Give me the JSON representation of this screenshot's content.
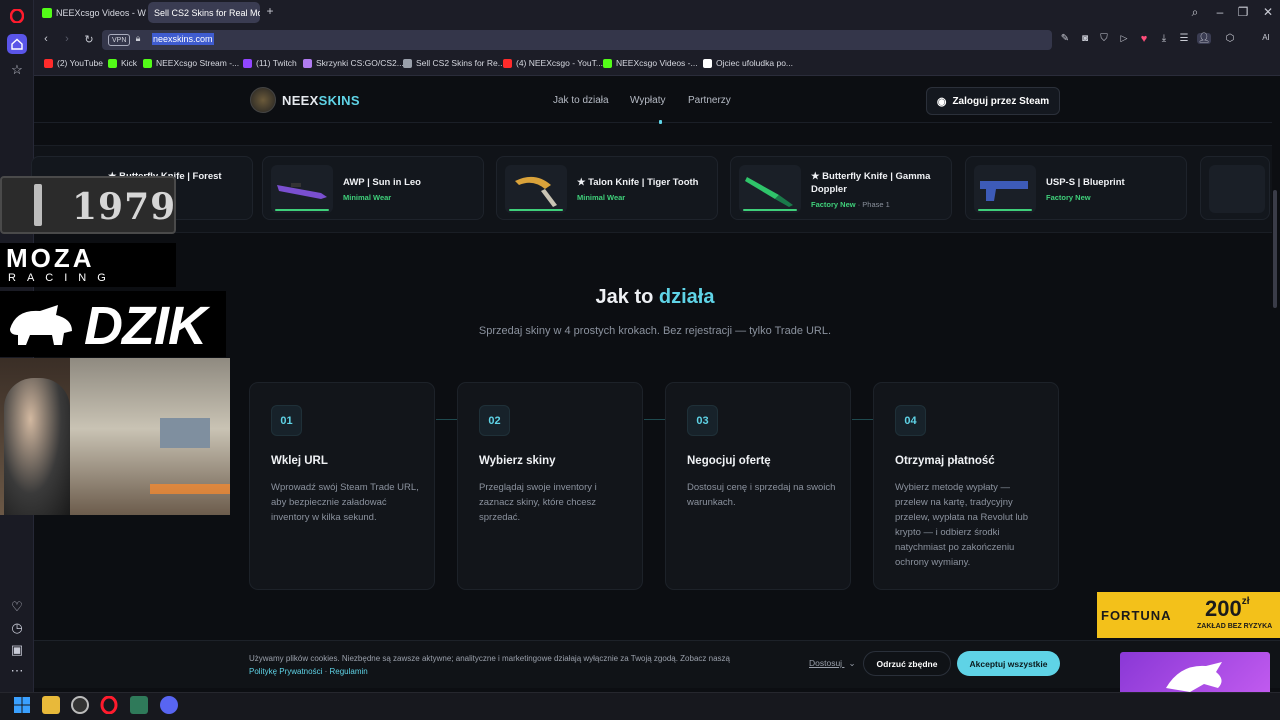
{
  "browser": {
    "tabs": [
      {
        "label": "NEEXcsgo Videos - Watch",
        "active": false
      },
      {
        "label": "Sell CS2 Skins for Real Mo",
        "active": true
      }
    ],
    "new_tab": "+",
    "url": "neexskins.com",
    "vpn_label": "VPN",
    "ai_label": "AI",
    "bookmarks": [
      {
        "label": "(2) YouTube",
        "icon": "youtube-icon",
        "color": "#ff2b2b"
      },
      {
        "label": "Kick",
        "icon": "kick-icon",
        "color": "#53fc18"
      },
      {
        "label": "NEEXcsgo Stream -...",
        "icon": "kick-icon",
        "color": "#53fc18"
      },
      {
        "label": "(11) Twitch",
        "icon": "twitch-icon",
        "color": "#9146ff"
      },
      {
        "label": "Skrzynki CS:GO/CS2...",
        "icon": "case-icon",
        "color": "#b07cf0"
      },
      {
        "label": "Sell CS2 Skins for Re...",
        "icon": "knife-icon",
        "color": "#9aa0ab"
      },
      {
        "label": "(4) NEEXcsgo - YouT...",
        "icon": "youtube-icon",
        "color": "#ff2b2b"
      },
      {
        "label": "NEEXcsgo Videos -...",
        "icon": "kick-icon",
        "color": "#53fc18"
      },
      {
        "label": "Ojciec ufoludka po...",
        "icon": "tiktok-icon",
        "color": "#ffffff"
      }
    ]
  },
  "site": {
    "logo_a": "NEEX",
    "logo_b": "SKINS",
    "nav": [
      "Jak to działa",
      "Wypłaty",
      "Partnerzy"
    ],
    "login_button": "Zaloguj przez Steam",
    "skins": [
      {
        "name": "★ Butterfly Knife | Forest",
        "condition": "",
        "phase": ""
      },
      {
        "name": "AWP | Sun in Leo",
        "condition": "Minimal Wear",
        "phase": ""
      },
      {
        "name": "★ Talon Knife | Tiger Tooth",
        "condition": "Minimal Wear",
        "phase": ""
      },
      {
        "name": "★ Butterfly Knife | Gamma Doppler",
        "condition": "Factory New",
        "phase": "· Phase 1"
      },
      {
        "name": "USP-S | Blueprint",
        "condition": "Factory New",
        "phase": ""
      }
    ],
    "heading_a": "Jak to",
    "heading_b": "działa",
    "subheading": "Sprzedaj skiny w 4 prostych krokach. Bez rejestracji — tylko Trade URL.",
    "steps": [
      {
        "num": "01",
        "title": "Wklej URL",
        "desc": "Wprowadź swój Steam Trade URL, aby bezpiecznie załadować inventory w kilka sekund."
      },
      {
        "num": "02",
        "title": "Wybierz skiny",
        "desc": "Przeglądaj swoje inventory i zaznacz skiny, które chcesz sprzedać."
      },
      {
        "num": "03",
        "title": "Negocjuj ofertę",
        "desc": "Dostosuj cenę i sprzedaj na swoich warunkach."
      },
      {
        "num": "04",
        "title": "Otrzymaj płatność",
        "desc": "Wybierz metodę wypłaty — przelew na kartę, tradycyjny przelew, wypłata na Revolut lub krypto — i odbierz środki natychmiast po zakończeniu ochrony wymiany."
      }
    ],
    "cookie": {
      "text": "Używamy plików cookies. Niezbędne są zawsze aktywne; analityczne i marketingowe działają wyłącznie za Twoją zgodą. Zobacz naszą",
      "link_privacy": "Politykę Prywatności",
      "separator": "·",
      "link_terms": "Regulamin",
      "customize": "Dostosuj",
      "reject": "Odrzuć zbędne",
      "accept": "Akceptuj wszystkie"
    }
  },
  "overlays": {
    "badge_1979": "1979",
    "moza_a": "MOZA",
    "moza_b": "RACING",
    "dzik": "DZIK",
    "fortuna_a": "FORTUNA",
    "fortuna_amount": "200",
    "fortuna_currency": "zł",
    "fortuna_b": "ZAKŁAD BEZ RYZYKA"
  },
  "colors": {
    "accent": "#5fd3e6",
    "condition": "#3fd07a",
    "background": "#0c0e12"
  }
}
